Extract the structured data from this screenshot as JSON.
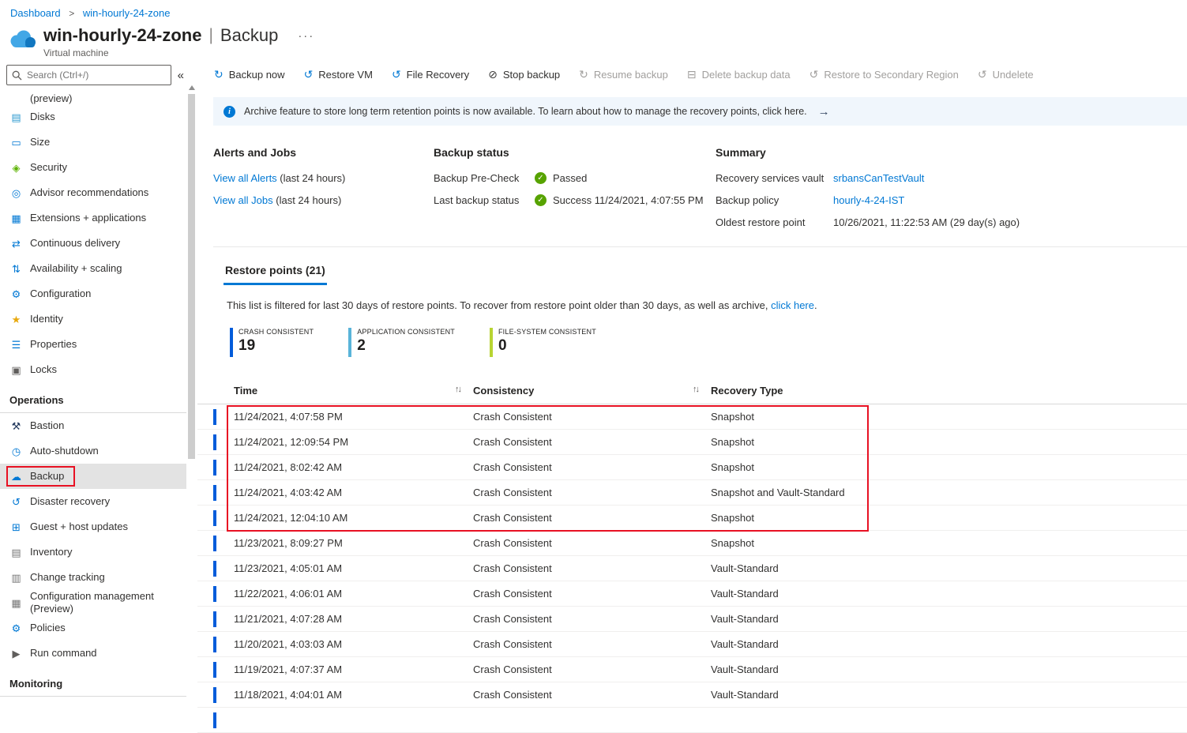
{
  "breadcrumb": {
    "items": [
      "Dashboard",
      "win-hourly-24-zone"
    ],
    "separator": ">"
  },
  "header": {
    "title": "win-hourly-24-zone",
    "divider": "|",
    "blade": "Backup",
    "more_label": "···",
    "subtitle": "Virtual machine"
  },
  "sidebar": {
    "search": {
      "placeholder": "Search (Ctrl+/)"
    },
    "collapse_glyph": "«",
    "partial_item": "(preview)",
    "operations_title": "Operations",
    "monitoring_title": "Monitoring",
    "general_items": [
      {
        "name": "sidebar-item-disks",
        "icon_name": "disks-icon",
        "glyph": "▤",
        "color": "#2f9ad0",
        "label": "Disks"
      },
      {
        "name": "sidebar-item-size",
        "icon_name": "size-icon",
        "glyph": "▭",
        "color": "#0078d4",
        "label": "Size"
      },
      {
        "name": "sidebar-item-security",
        "icon_name": "security-shield-icon",
        "glyph": "◈",
        "color": "#5db300",
        "label": "Security"
      },
      {
        "name": "sidebar-item-advisor-recommendations",
        "icon_name": "advisor-icon",
        "glyph": "◎",
        "color": "#0078d4",
        "label": "Advisor recommendations"
      },
      {
        "name": "sidebar-item-extensions-applications",
        "icon_name": "extensions-icon",
        "glyph": "▦",
        "color": "#0078d4",
        "label": "Extensions + applications"
      },
      {
        "name": "sidebar-item-continuous-delivery",
        "icon_name": "continuous-delivery-icon",
        "glyph": "⇄",
        "color": "#0078d4",
        "label": "Continuous delivery"
      },
      {
        "name": "sidebar-item-availability-scaling",
        "icon_name": "availability-scaling-icon",
        "glyph": "⇅",
        "color": "#0078d4",
        "label": "Availability + scaling"
      },
      {
        "name": "sidebar-item-configuration",
        "icon_name": "configuration-gear-icon",
        "glyph": "⚙",
        "color": "#0078d4",
        "label": "Configuration"
      },
      {
        "name": "sidebar-item-identity",
        "icon_name": "identity-icon",
        "glyph": "★",
        "color": "#e8a80c",
        "label": "Identity"
      },
      {
        "name": "sidebar-item-properties",
        "icon_name": "properties-icon",
        "glyph": "☰",
        "color": "#0078d4",
        "label": "Properties"
      },
      {
        "name": "sidebar-item-locks",
        "icon_name": "lock-icon",
        "glyph": "▣",
        "color": "#605e5c",
        "label": "Locks"
      }
    ],
    "operations_items": [
      {
        "name": "sidebar-item-bastion",
        "icon_name": "bastion-icon",
        "glyph": "⚒",
        "color": "#243a5e",
        "label": "Bastion"
      },
      {
        "name": "sidebar-item-auto-shutdown",
        "icon_name": "auto-shutdown-clock-icon",
        "glyph": "◷",
        "color": "#0078d4",
        "label": "Auto-shutdown"
      },
      {
        "name": "sidebar-item-backup",
        "icon_name": "backup-cloud-icon",
        "glyph": "☁",
        "color": "#0078d4",
        "label": "Backup",
        "selected": true,
        "outlined": true
      },
      {
        "name": "sidebar-item-disaster-recovery",
        "icon_name": "disaster-recovery-icon",
        "glyph": "↺",
        "color": "#0078d4",
        "label": "Disaster recovery"
      },
      {
        "name": "sidebar-item-guest-host-updates",
        "icon_name": "guest-host-updates-icon",
        "glyph": "⊞",
        "color": "#0078d4",
        "label": "Guest + host updates"
      },
      {
        "name": "sidebar-item-inventory",
        "icon_name": "inventory-icon",
        "glyph": "▤",
        "color": "#767676",
        "label": "Inventory"
      },
      {
        "name": "sidebar-item-change-tracking",
        "icon_name": "change-tracking-icon",
        "glyph": "▥",
        "color": "#767676",
        "label": "Change tracking"
      },
      {
        "name": "sidebar-item-configuration-management",
        "icon_name": "configuration-management-icon",
        "glyph": "▦",
        "color": "#767676",
        "label": "Configuration management (Preview)"
      },
      {
        "name": "sidebar-item-policies",
        "icon_name": "policies-gear-icon",
        "glyph": "⚙",
        "color": "#0078d4",
        "label": "Policies"
      },
      {
        "name": "sidebar-item-run-command",
        "icon_name": "run-command-icon",
        "glyph": "▶",
        "color": "#605e5c",
        "label": "Run command"
      }
    ]
  },
  "toolbar": {
    "items": [
      {
        "name": "backup-now-button",
        "icon_name": "backup-now-icon",
        "glyph": "↻",
        "color": "#0078d4",
        "label": "Backup now"
      },
      {
        "name": "restore-vm-button",
        "icon_name": "restore-vm-icon",
        "glyph": "↺",
        "color": "#0078d4",
        "label": "Restore VM"
      },
      {
        "name": "file-recovery-button",
        "icon_name": "file-recovery-icon",
        "glyph": "↺",
        "color": "#0078d4",
        "label": "File Recovery"
      },
      {
        "name": "stop-backup-button",
        "icon_name": "stop-backup-icon",
        "glyph": "⊘",
        "color": "#3b3a39",
        "label": "Stop backup"
      },
      {
        "name": "resume-backup-button",
        "icon_name": "resume-backup-icon",
        "glyph": "↻",
        "color": "#a19f9d",
        "label": "Resume backup",
        "disabled": true
      },
      {
        "name": "delete-backup-data-button",
        "icon_name": "delete-trash-icon",
        "glyph": "⊟",
        "color": "#a19f9d",
        "label": "Delete backup data",
        "disabled": true
      },
      {
        "name": "restore-secondary-region-button",
        "icon_name": "restore-secondary-region-icon",
        "glyph": "↺",
        "color": "#a19f9d",
        "label": "Restore to Secondary Region",
        "disabled": true
      },
      {
        "name": "undelete-button",
        "icon_name": "undelete-icon",
        "glyph": "↺",
        "color": "#a19f9d",
        "label": "Undelete",
        "disabled": true
      }
    ]
  },
  "banner": {
    "info_glyph": "i",
    "text": "Archive feature to store long term retention points is now available. To learn about how to manage the recovery points, click here.",
    "arrow": "→"
  },
  "alerts_jobs": {
    "title": "Alerts and Jobs",
    "links": [
      {
        "link": "View all Alerts",
        "suffix": " (last 24 hours)"
      },
      {
        "link": "View all Jobs",
        "suffix": " (last 24 hours)"
      }
    ]
  },
  "backup_status": {
    "title": "Backup status",
    "check_glyph": "✓",
    "rows": [
      {
        "label": "Backup Pre-Check",
        "value": "Passed"
      },
      {
        "label": "Last backup status",
        "value": "Success 11/24/2021, 4:07:55 PM"
      }
    ]
  },
  "summary": {
    "title": "Summary",
    "rows": [
      {
        "label": "Recovery services vault",
        "value": "srbansCanTestVault",
        "is_link": true
      },
      {
        "label": "Backup policy",
        "value": "hourly-4-24-IST",
        "is_link": true
      },
      {
        "label": "Oldest restore point",
        "value": "10/26/2021, 11:22:53 AM (29 day(s) ago)",
        "is_link": false
      }
    ]
  },
  "restore_points": {
    "tab_label": "Restore points (21)",
    "filter_note_prefix": "This list is filtered for last 30 days of restore points. To recover from restore point older than 30 days, as well as archive, ",
    "filter_note_link": "click here",
    "filter_note_suffix": ".",
    "stats": [
      {
        "label": "CRASH CONSISTENT",
        "value": "19",
        "color": "#015cda"
      },
      {
        "label": "APPLICATION CONSISTENT",
        "value": "2",
        "color": "#59b4d9"
      },
      {
        "label": "FILE-SYSTEM CONSISTENT",
        "value": "0",
        "color": "#b8d432"
      }
    ],
    "table": {
      "columns": [
        "Time",
        "Consistency",
        "Recovery Type"
      ],
      "sort_glyph": "↑↓",
      "highlighted_rows": 5,
      "rows": [
        {
          "time": "11/24/2021, 4:07:58 PM",
          "consistency": "Crash Consistent",
          "recovery_type": "Snapshot"
        },
        {
          "time": "11/24/2021, 12:09:54 PM",
          "consistency": "Crash Consistent",
          "recovery_type": "Snapshot"
        },
        {
          "time": "11/24/2021, 8:02:42 AM",
          "consistency": "Crash Consistent",
          "recovery_type": "Snapshot"
        },
        {
          "time": "11/24/2021, 4:03:42 AM",
          "consistency": "Crash Consistent",
          "recovery_type": "Snapshot and Vault-Standard"
        },
        {
          "time": "11/24/2021, 12:04:10 AM",
          "consistency": "Crash Consistent",
          "recovery_type": "Snapshot"
        },
        {
          "time": "11/23/2021, 8:09:27 PM",
          "consistency": "Crash Consistent",
          "recovery_type": "Snapshot"
        },
        {
          "time": "11/23/2021, 4:05:01 AM",
          "consistency": "Crash Consistent",
          "recovery_type": "Vault-Standard"
        },
        {
          "time": "11/22/2021, 4:06:01 AM",
          "consistency": "Crash Consistent",
          "recovery_type": "Vault-Standard"
        },
        {
          "time": "11/21/2021, 4:07:28 AM",
          "consistency": "Crash Consistent",
          "recovery_type": "Vault-Standard"
        },
        {
          "time": "11/20/2021, 4:03:03 AM",
          "consistency": "Crash Consistent",
          "recovery_type": "Vault-Standard"
        },
        {
          "time": "11/19/2021, 4:07:37 AM",
          "consistency": "Crash Consistent",
          "recovery_type": "Vault-Standard"
        },
        {
          "time": "11/18/2021, 4:04:01 AM",
          "consistency": "Crash Consistent",
          "recovery_type": "Vault-Standard"
        },
        {
          "time": "",
          "consistency": "",
          "recovery_type": ""
        }
      ]
    }
  },
  "colors": {
    "accent": "#0078d4",
    "success_green": "#57a300",
    "highlight_red": "#e81123",
    "row_accent_blue": "#015cda"
  }
}
